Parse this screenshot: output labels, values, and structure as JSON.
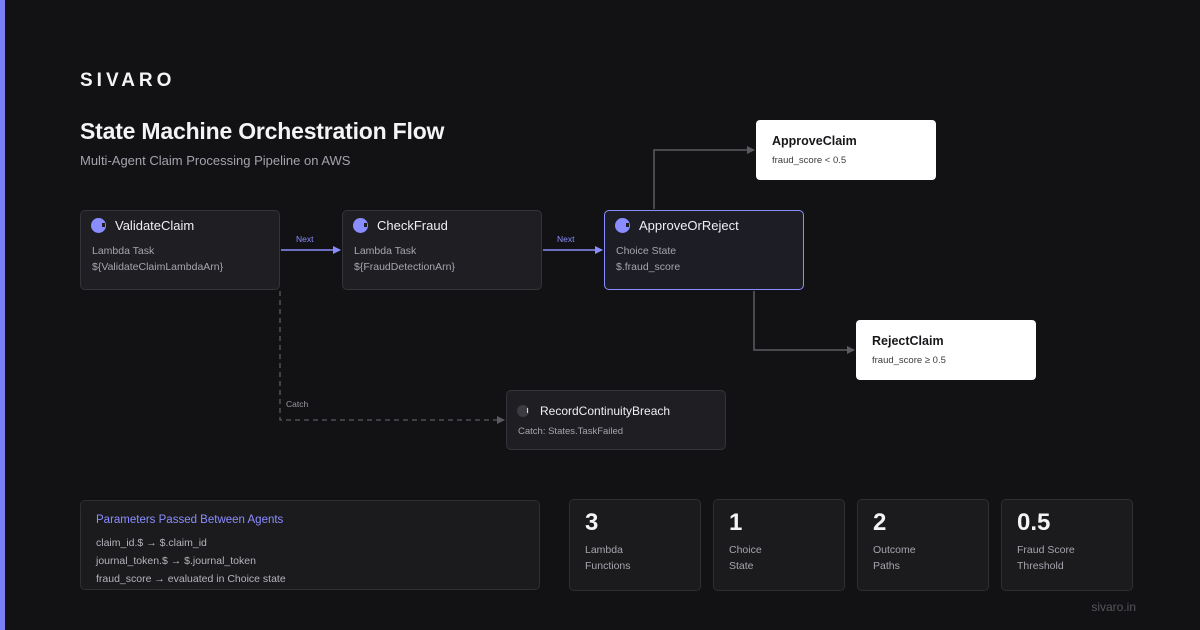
{
  "brand": "SIVARO",
  "title": "State Machine Orchestration Flow",
  "subtitle": "Multi-Agent Claim Processing Pipeline on AWS",
  "nodes": {
    "validate": {
      "title": "ValidateClaim",
      "type": "Lambda Task",
      "detail": "${ValidateClaimLambdaArn}"
    },
    "fraud": {
      "title": "CheckFraud",
      "type": "Lambda Task",
      "detail": "${FraudDetectionArn}"
    },
    "choice": {
      "title": "ApproveOrReject",
      "type": "Choice State",
      "detail": "$.fraud_score"
    },
    "approve": {
      "title": "ApproveClaim",
      "condition": "fraud_score < 0.5"
    },
    "reject": {
      "title": "RejectClaim",
      "condition": "fraud_score ≥ 0.5"
    },
    "breach": {
      "title": "RecordContinuityBreach",
      "detail": "Catch: States.TaskFailed"
    }
  },
  "edges": {
    "next1": "Next",
    "next2": "Next",
    "catch": "Catch"
  },
  "params": {
    "title": "Parameters Passed Between Agents",
    "lines": [
      "claim_id.$ → $.claim_id",
      "journal_token.$ → $.journal_token",
      "fraud_score → evaluated in Choice state"
    ]
  },
  "stats": [
    {
      "value": "3",
      "label_1": "Lambda",
      "label_2": "Functions"
    },
    {
      "value": "1",
      "label_1": "Choice",
      "label_2": "State"
    },
    {
      "value": "2",
      "label_1": "Outcome",
      "label_2": "Paths"
    },
    {
      "value": "0.5",
      "label_1": "Fraud Score",
      "label_2": "Threshold"
    }
  ],
  "footer": "sivaro.in",
  "colors": {
    "accent": "#7b7ff7",
    "background": "#121214",
    "node": "#1f1f23",
    "edge": "#5a5a60"
  }
}
